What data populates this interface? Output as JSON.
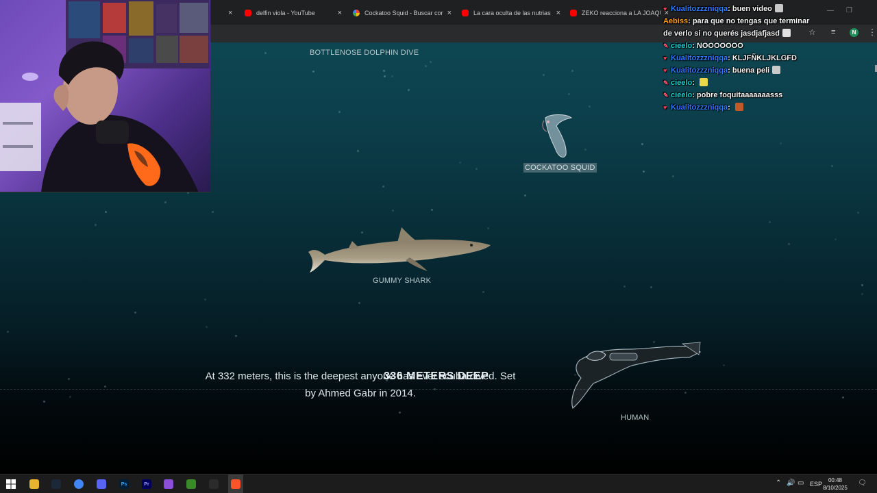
{
  "browser": {
    "tabs": [
      {
        "title": "",
        "icon": "none-icon"
      },
      {
        "title": "delfin viola - YouTube",
        "icon": "youtube-icon"
      },
      {
        "title": "Cockatoo Squid - Buscar con Google",
        "icon": "google-icon"
      },
      {
        "title": "La cara oculta de las nutrias y la",
        "icon": "youtube-icon"
      },
      {
        "title": "ZEKO reacciona a LA JOAQUI | A",
        "icon": "youtube-icon"
      }
    ],
    "close_glyph": "×",
    "profile_initial": "N"
  },
  "scene": {
    "labels": {
      "dolphin_dive": "BOTTLENOSE DOLPHIN DIVE",
      "cockatoo_squid": "COCKATOO SQUID",
      "gummy_shark": "GUMMY SHARK",
      "human": "HUMAN"
    },
    "depth_readout": "336 METERS DEEP",
    "fact_text": "At 332 meters, this is the deepest anyone has ever scuba dived. Set by Ahmed Gabr in 2014."
  },
  "chat": {
    "messages": [
      {
        "user": "Kualitozzzniqqa",
        "text": "buen video",
        "badge": "heart",
        "user_color": "#2f7bff",
        "emote": "bunny"
      },
      {
        "user": "Aebiss",
        "text": "para que no tengas que terminar",
        "badge": "",
        "user_color": "#ff9f1c",
        "emote": ""
      },
      {
        "user": "",
        "text": "de verlo si no querés jasdjafjasd",
        "badge": "",
        "user_color": "#ffffff",
        "emote": "box"
      },
      {
        "user": "cieelo",
        "text": "NOOOOOOO",
        "badge": "pencil",
        "user_color": "#19d0d0",
        "emote": ""
      },
      {
        "user": "Kualitozzzniqqa",
        "text": "KLJFÑKLJKLGFD",
        "badge": "heart",
        "user_color": "#2f7bff",
        "emote": ""
      },
      {
        "user": "Kualitozzzniqqa",
        "text": "buena peli",
        "badge": "heart",
        "user_color": "#2f7bff",
        "emote": "bunny"
      },
      {
        "user": "cieelo",
        "text": "",
        "badge": "pencil",
        "user_color": "#19d0d0",
        "emote": "sunglasses"
      },
      {
        "user": "cieelo",
        "text": "pobre foquitaaaaaaasss",
        "badge": "pencil",
        "user_color": "#19d0d0",
        "emote": ""
      },
      {
        "user": "Kualitozzzniqqa",
        "text": "",
        "badge": "heart",
        "user_color": "#2f7bff",
        "emote": "cat"
      }
    ]
  },
  "taskbar": {
    "apps": [
      {
        "name": "file-explorer-icon",
        "label": ""
      },
      {
        "name": "steam-icon",
        "label": ""
      },
      {
        "name": "chrome-icon",
        "label": ""
      },
      {
        "name": "discord-icon",
        "label": ""
      },
      {
        "name": "photoshop-icon",
        "label": "Ps"
      },
      {
        "name": "premiere-icon",
        "label": "Pr"
      },
      {
        "name": "podcast-icon",
        "label": ""
      },
      {
        "name": "minecraft-icon",
        "label": ""
      },
      {
        "name": "obs-icon",
        "label": ""
      },
      {
        "name": "brave-icon",
        "label": ""
      }
    ],
    "language": "ESP",
    "time": "00:48",
    "date": "8/10/2025"
  }
}
